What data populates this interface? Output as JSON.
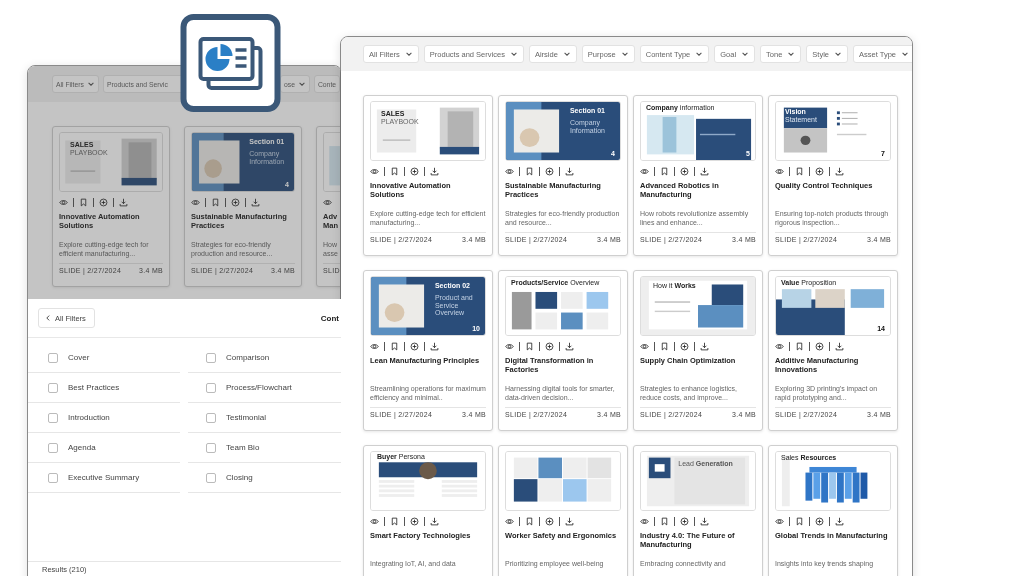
{
  "back_window": {
    "filters": [
      {
        "label": "All Filters",
        "chevron": true
      },
      {
        "label": "Products and Servic",
        "chevron": false
      },
      {
        "label": "ose",
        "chevron": true
      },
      {
        "label": "Conte",
        "chevron": false
      }
    ],
    "cards": [
      {
        "thumb": {
          "kind": "cover",
          "heading": "SALES",
          "subheading": "PLAYBOOK"
        },
        "title": "Innovative Automation Solutions",
        "description": "Explore cutting-edge tech for efficient manufacturing...",
        "meta": "SLIDE | 2/27/2024",
        "size": "3.4 MB"
      },
      {
        "thumb": {
          "kind": "section",
          "heading": "Section 01",
          "subheading": "Company Information",
          "number": "4"
        },
        "title": "Sustainable Manufacturing Practices",
        "description": "Strategies for eco-friendly production and resource...",
        "meta": "SLIDE | 2/27/2024",
        "size": "3.4 MB"
      },
      {
        "partial": true,
        "thumb": {
          "kind": "info"
        },
        "title": "Adv Man",
        "description": "How asse",
        "meta": "SLID"
      }
    ],
    "filter_panel": {
      "back_label": "All Filters",
      "heading": "Cont",
      "options": [
        {
          "label": "Cover",
          "checked": false
        },
        {
          "label": "Comparison",
          "checked": false
        },
        {
          "label": "Best Practices",
          "checked": false
        },
        {
          "label": "Process/Flowchart",
          "checked": false
        },
        {
          "label": "Introduction",
          "checked": false
        },
        {
          "label": "Testimonial",
          "checked": false
        },
        {
          "label": "Agenda",
          "checked": false
        },
        {
          "label": "Team Bio",
          "checked": false
        },
        {
          "label": "Executive Summary",
          "checked": false
        },
        {
          "label": "Closing",
          "checked": false
        }
      ],
      "results": "Results (210)"
    }
  },
  "main_window": {
    "filters": [
      {
        "label": "All Filters",
        "chevron": true
      },
      {
        "label": "Products and Services",
        "chevron": true
      },
      {
        "label": "Airside",
        "chevron": true
      },
      {
        "label": "Purpose",
        "chevron": true
      },
      {
        "label": "Content Type",
        "chevron": true
      },
      {
        "label": "Goal",
        "chevron": true
      },
      {
        "label": "Tone",
        "chevron": true
      },
      {
        "label": "Style",
        "chevron": true
      },
      {
        "label": "Asset Type",
        "chevron": true
      }
    ],
    "cards": [
      {
        "thumb": {
          "kind": "cover",
          "heading": "SALES",
          "subheading": "PLAYBOOK"
        },
        "title": "Innovative Automation Solutions",
        "description": "Explore cutting-edge tech for efficient manufacturing...",
        "meta": "SLIDE | 2/27/2024",
        "size": "3.4 MB"
      },
      {
        "thumb": {
          "kind": "section",
          "heading": "Section 01",
          "subheading": "Company Information",
          "number": "4"
        },
        "title": "Sustainable Manufacturing Practices",
        "description": "Strategies for eco-friendly production and resource...",
        "meta": "SLIDE | 2/27/2024",
        "size": "3.4 MB"
      },
      {
        "thumb": {
          "kind": "info",
          "heading": "**Company** information",
          "number": "5"
        },
        "title": "Advanced Robotics in Manufacturing",
        "description": "How robots revolutionize assembly lines and enhance...",
        "meta": "SLIDE | 2/27/2024",
        "size": "3.4 MB"
      },
      {
        "thumb": {
          "kind": "vision",
          "heading": "Vision",
          "subheading": "Statement",
          "number": "7"
        },
        "title": "Quality Control Techniques",
        "description": "Ensuring top-notch products through rigorous inspection...",
        "meta": "SLIDE | 2/27/2024",
        "size": "3.4 MB"
      },
      {
        "thumb": {
          "kind": "section",
          "heading": "Section 02",
          "subheading": "Product and Service Overview",
          "number": "10"
        },
        "title": "Lean Manufacturing Principles",
        "description": "Streamlining operations for maximum efficiency and minimal..",
        "meta": "SLIDE | 2/27/2024",
        "size": "3.4 MB"
      },
      {
        "thumb": {
          "kind": "grid",
          "heading": "**Products/Service** Overview"
        },
        "title": "Digital Transformation in Factories",
        "description": "Harnessing digital tools for smarter, data-driven decision...",
        "meta": "SLIDE | 2/27/2024",
        "size": "3.4 MB"
      },
      {
        "thumb": {
          "kind": "how",
          "heading": "How it **Works**"
        },
        "title": "Supply Chain Optimization",
        "description": "Strategies to enhance logistics, reduce costs, and improve...",
        "meta": "SLIDE | 2/27/2024",
        "size": "3.4 MB"
      },
      {
        "thumb": {
          "kind": "value",
          "heading": "**Value** Proposition",
          "number": "14"
        },
        "title": "Additive Manufacturing Innovations",
        "description": "Exploring 3D printing's impact on rapid prototyping and...",
        "meta": "SLIDE | 2/27/2024",
        "size": "3.4 MB"
      },
      {
        "thumb": {
          "kind": "persona",
          "heading": "**Buyer** Persona"
        },
        "title": "Smart Factory Technologies",
        "description": "Integrating IoT, AI, and data"
      },
      {
        "thumb": {
          "kind": "tiles"
        },
        "title": "Worker Safety and Ergonomics",
        "description": "Prioritizing employee well-being"
      },
      {
        "thumb": {
          "kind": "lead",
          "heading": "Lead **Generation**"
        },
        "title": "Industry 4.0: The Future of Manufacturing",
        "description": "Embracing connectivity and"
      },
      {
        "thumb": {
          "kind": "resources",
          "heading": "Sales **Resources**"
        },
        "title": "Global Trends in Manufacturing",
        "description": "Insights into key trends shaping"
      }
    ]
  }
}
